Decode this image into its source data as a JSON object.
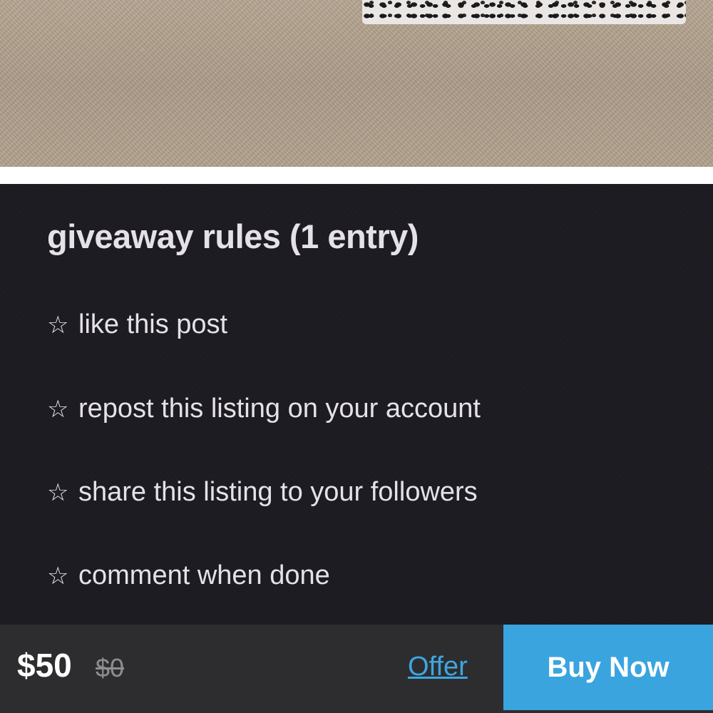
{
  "listing": {
    "photo_alt": "listing photo",
    "description": {
      "title": "giveaway rules (1 entry)",
      "rules": [
        {
          "icon": "☆",
          "icon_name": "star-outline-icon",
          "text": "like this post"
        },
        {
          "icon": "☆",
          "icon_name": "star-outline-icon",
          "text": "repost this listing on your account"
        },
        {
          "icon": "☆",
          "icon_name": "star-outline-icon",
          "text": "share this listing to your followers"
        },
        {
          "icon": "☆",
          "icon_name": "star-outline-icon",
          "text": "comment when done"
        }
      ]
    }
  },
  "purchase_bar": {
    "price": "$50",
    "original_price": "$0",
    "offer_label": "Offer",
    "buy_label": "Buy Now"
  },
  "colors": {
    "description_bg": "#1c1b21",
    "bar_bg": "#2d2d2f",
    "accent": "#3aa4df",
    "text_light": "#e4e2e6",
    "muted": "#8e8e92"
  }
}
